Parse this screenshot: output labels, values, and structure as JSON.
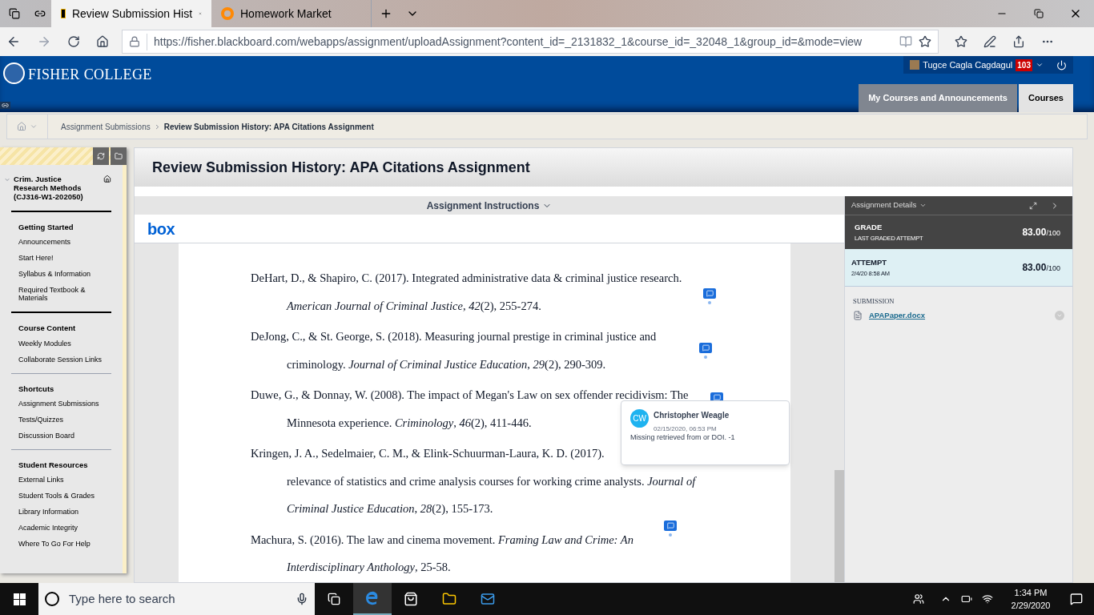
{
  "browser": {
    "tabs": [
      {
        "title": "Review Submission Hist",
        "selected": true,
        "kind": "bb"
      },
      {
        "title": "Homework Market",
        "selected": false,
        "kind": "ring"
      }
    ],
    "url": "https://fisher.blackboard.com/webapps/assignment/uploadAssignment?content_id=_2131832_1&course_id=_32048_1&group_id=&mode=view"
  },
  "header": {
    "logo_text": "FISHER COLLEGE",
    "user": "Tugce Cagla Cagdagul",
    "badge": "103",
    "nav_tabs": [
      {
        "label": "My Courses and Announcements",
        "selected": false
      },
      {
        "label": "Courses",
        "selected": true
      }
    ]
  },
  "breadcrumb": [
    "Assignment Submissions",
    "Review Submission History: APA Citations Assignment"
  ],
  "sidebar": {
    "course_title": "Crim. Justice Research Methods (CJ316-W1-202050)",
    "sections": [
      {
        "heading": "Getting Started",
        "items": [
          "Announcements",
          "Start Here!",
          "Syllabus & Information",
          "Required Textbook & Materials"
        ]
      },
      {
        "heading": "Course Content",
        "items": [
          "Weekly Modules",
          "Collaborate Session Links"
        ]
      },
      {
        "heading": "Shortcuts",
        "items": [
          "Assignment Submissions",
          "Tests/Quizzes",
          "Discussion Board"
        ]
      },
      {
        "heading": "Student Resources",
        "items": [
          "External Links",
          "Student Tools & Grades",
          "Library Information",
          "Academic Integrity",
          "Where To Go For Help"
        ]
      }
    ]
  },
  "page_title": "Review Submission History: APA Citations Assignment",
  "instructions_label": "Assignment Instructions",
  "viewer_logo": "box",
  "references": [
    {
      "lines": [
        "DeHart, D., & Shapiro, C. (2017). Integrated administrative data & criminal justice research.",
        "*American Journal of Criminal Justice*, *42*(2), 255-274."
      ],
      "comment": true
    },
    {
      "lines": [
        "DeJong, C., & St. George, S. (2018). Measuring journal prestige in criminal justice and",
        "criminology. *Journal of Criminal Justice Education*, *29*(2), 290-309."
      ],
      "comment": true
    },
    {
      "lines": [
        "Duwe, G., & Donnay, W. (2008). The impact of Megan's Law on sex offender recidivism: The",
        "Minnesota experience. *Criminology*, *46*(2), 411-446."
      ],
      "comment": true
    },
    {
      "lines": [
        "Kringen, J. A., Sedelmaier, C. M., & Elink-Schuurman-Laura, K. D. (2017).",
        "relevance of statistics and crime analysis courses for working crime analysts. *Journal of*",
        "*Criminal Justice Education*, *28*(2), 155-173."
      ],
      "comment": false
    },
    {
      "lines": [
        "Machura, S. (2016). The law and cinema movement. *Framing Law and Crime: An*",
        "*Interdisciplinary Anthology*, 25-58."
      ],
      "comment": true
    }
  ],
  "comment_popup": {
    "initials": "CW",
    "author": "Christopher Weagle",
    "date": "02/15/2020, 06:53 PM",
    "text": "Missing retrieved from or DOI. -1"
  },
  "details": {
    "title": "Assignment Details",
    "grade": {
      "label": "GRADE",
      "sublabel": "LAST GRADED ATTEMPT",
      "score": "83.00",
      "out_of": "/100"
    },
    "attempt": {
      "label": "ATTEMPT",
      "sublabel": "2/4/20 8:58 AM",
      "score": "83.00",
      "out_of": "/100"
    },
    "submission": {
      "label": "SUBMISSION",
      "file": "APAPaper.docx"
    }
  },
  "taskbar": {
    "search_placeholder": "Type here to search",
    "time": "1:34 PM",
    "date": "2/29/2020"
  }
}
